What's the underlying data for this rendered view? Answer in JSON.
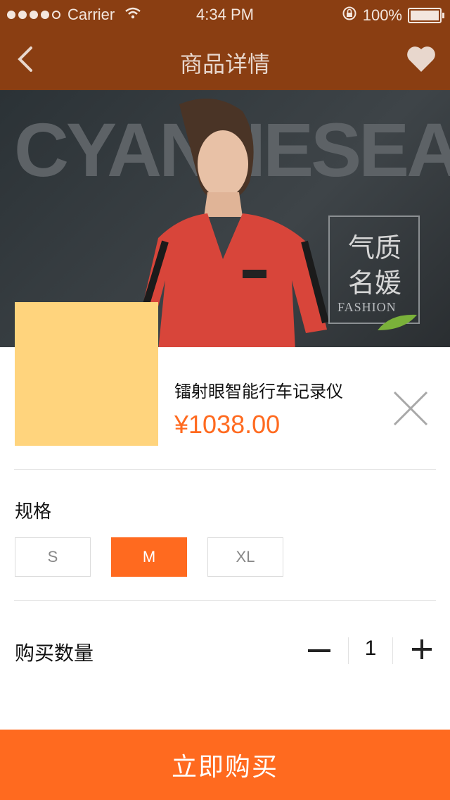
{
  "status_bar": {
    "carrier": "Carrier",
    "time": "4:34 PM",
    "battery": "100%",
    "signal_dots": [
      true,
      true,
      true,
      true,
      false
    ]
  },
  "nav": {
    "title": "商品详情",
    "back_icon": "chevron-left-icon",
    "favorite_icon": "heart-icon"
  },
  "hero": {
    "brand_text": "CYANNESEA",
    "badge_line1": "气质",
    "badge_line2": "名媛",
    "badge_sub": "FASHION"
  },
  "product": {
    "name": "镭射眼智能行车记录仪",
    "price": "¥1038.00",
    "thumb_color": "#ffd47d"
  },
  "spec": {
    "label": "规格",
    "options": [
      "S",
      "M",
      "XL"
    ],
    "selected": "M"
  },
  "quantity": {
    "label": "购买数量",
    "value": "1"
  },
  "buy_button": {
    "label": "立即购买",
    "color": "#ff6a1f"
  },
  "colors": {
    "nav_bg": "#8a3e12",
    "accent": "#ff6a1f"
  }
}
